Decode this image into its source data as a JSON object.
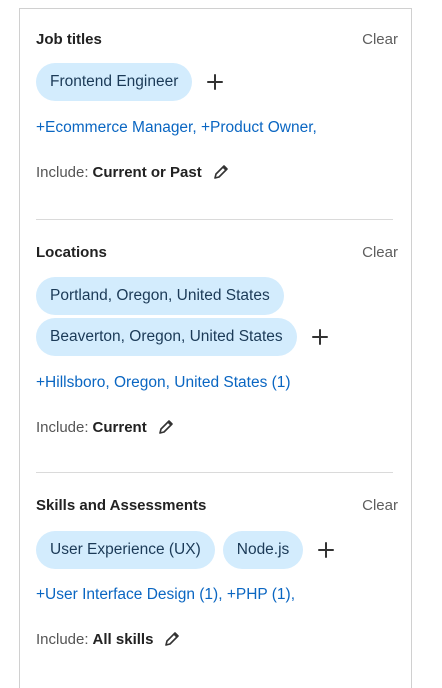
{
  "sections": [
    {
      "title": "Job titles",
      "clear_label": "Clear",
      "chips": [
        "Frontend Engineer"
      ],
      "suggestions": "+Ecommerce Manager, +Product Owner,",
      "include_label": "Include:",
      "include_value": "Current or Past"
    },
    {
      "title": "Locations",
      "clear_label": "Clear",
      "chips": [
        "Portland, Oregon, United States",
        "Beaverton, Oregon, United States"
      ],
      "suggestions": "+Hillsboro, Oregon, United States (1)",
      "include_label": "Include:",
      "include_value": "Current"
    },
    {
      "title": "Skills and Assessments",
      "clear_label": "Clear",
      "chips": [
        "User Experience (UX)",
        "Node.js"
      ],
      "suggestions": "+User Interface Design (1), +PHP (1),",
      "include_label": "Include:",
      "include_value": "All skills"
    }
  ],
  "icons": {
    "add": "plus-icon",
    "edit": "pencil-icon"
  },
  "colors": {
    "chip_bg": "#d3ecfd",
    "link": "#0a66c2",
    "text": "#222222"
  }
}
